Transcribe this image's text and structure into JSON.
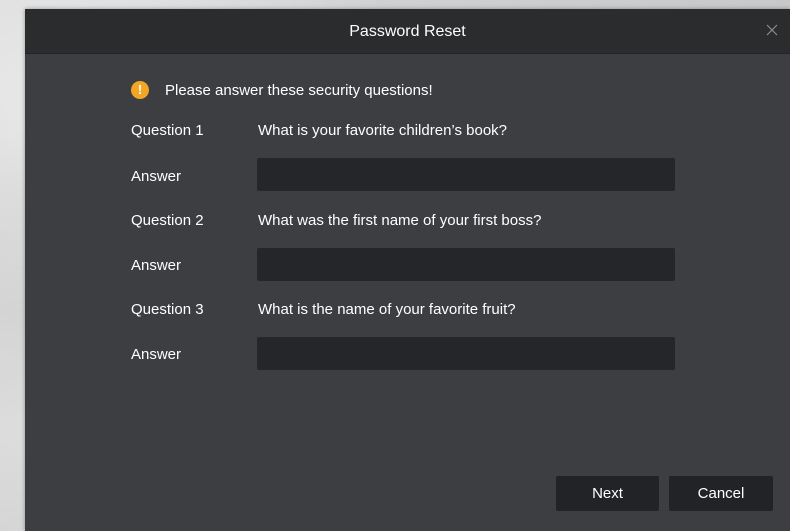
{
  "dialog": {
    "title": "Password Reset",
    "close_icon": "close-icon"
  },
  "notice": {
    "icon": "warning-icon",
    "icon_glyph": "!",
    "icon_color": "#f3a526",
    "text": "Please answer these security questions!"
  },
  "questions": [
    {
      "label": "Question 1",
      "text": "What is your favorite children’s book?",
      "answer_label": "Answer",
      "answer_value": ""
    },
    {
      "label": "Question 2",
      "text": "What was the first name of your first boss?",
      "answer_label": "Answer",
      "answer_value": ""
    },
    {
      "label": "Question 3",
      "text": "What is the name of your favorite fruit?",
      "answer_label": "Answer",
      "answer_value": ""
    }
  ],
  "buttons": {
    "next_label": "Next",
    "cancel_label": "Cancel"
  }
}
